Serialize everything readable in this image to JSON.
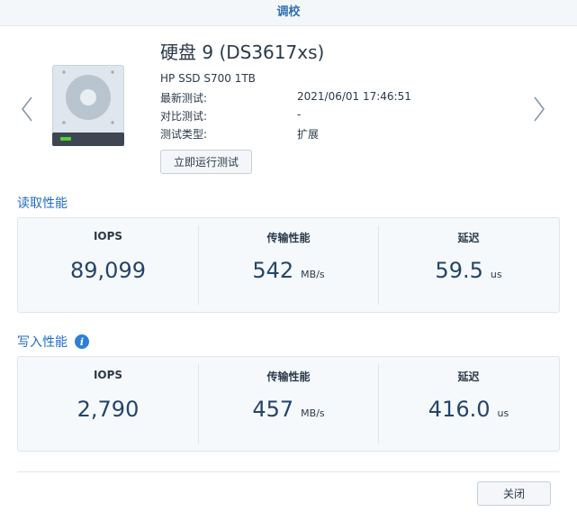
{
  "window": {
    "title": "调校"
  },
  "disk": {
    "title": "硬盘 9 (DS3617xs)",
    "model": "HP SSD S700 1TB",
    "info": [
      {
        "label": "最新测试:",
        "value": "2021/06/01 17:46:51"
      },
      {
        "label": "对比测试:",
        "value": "-"
      },
      {
        "label": "测试类型:",
        "value": "扩展"
      }
    ],
    "run_button": "立即运行测试"
  },
  "read": {
    "section_title": "读取性能",
    "metrics": [
      {
        "label": "IOPS",
        "value": "89,099",
        "unit": ""
      },
      {
        "label": "传输性能",
        "value": "542",
        "unit": "MB/s"
      },
      {
        "label": "延迟",
        "value": "59.5",
        "unit": "us"
      }
    ]
  },
  "write": {
    "section_title": "写入性能",
    "metrics": [
      {
        "label": "IOPS",
        "value": "2,790",
        "unit": ""
      },
      {
        "label": "传输性能",
        "value": "457",
        "unit": "MB/s"
      },
      {
        "label": "延迟",
        "value": "416.0",
        "unit": "us"
      }
    ]
  },
  "footer": {
    "close_button": "关闭"
  },
  "icons": {
    "prev": "chevron-left-icon",
    "next": "chevron-right-icon",
    "disk": "hard-disk-icon",
    "info": "info-icon"
  },
  "colors": {
    "accent": "#1f6cc4",
    "value_text": "#23456a",
    "panel_bg": "#f6f9fc",
    "disk_led": "#4cd137"
  }
}
